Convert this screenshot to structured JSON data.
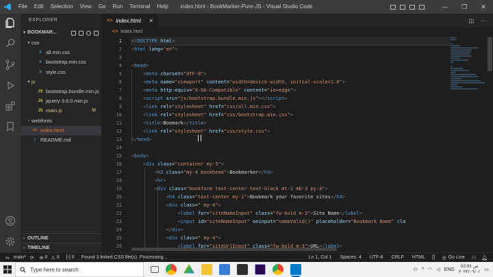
{
  "window": {
    "title": "index.html - BookMarker-Pure-JS - Visual Studio Code",
    "menu": [
      "File",
      "Edit",
      "Selection",
      "View",
      "Go",
      "Run",
      "Terminal",
      "Help"
    ],
    "controls": [
      "—",
      "❐",
      "✕"
    ]
  },
  "sidebar": {
    "title": "EXPLORER",
    "project": "BOOKMAR...",
    "tree": [
      {
        "label": "css",
        "type": "folder",
        "depth": 1,
        "open": true
      },
      {
        "label": "all.min.css",
        "type": "css",
        "depth": 2
      },
      {
        "label": "bootstrap.min.css",
        "type": "css",
        "depth": 2
      },
      {
        "label": "style.css",
        "type": "css",
        "depth": 2
      },
      {
        "label": "js",
        "type": "folder",
        "depth": 1,
        "open": true,
        "modified": true
      },
      {
        "label": "bootstrap.bundle.min.js",
        "type": "js",
        "depth": 2
      },
      {
        "label": "jquery-3.6.0.min.js",
        "type": "js",
        "depth": 2
      },
      {
        "label": "main.js",
        "type": "js",
        "depth": 2,
        "badge": "M",
        "modified": true
      },
      {
        "label": "webfonts",
        "type": "folder",
        "depth": 1,
        "open": false
      },
      {
        "label": "index.html",
        "type": "html",
        "depth": 1,
        "active": true
      },
      {
        "label": "README.md",
        "type": "md",
        "depth": 1
      }
    ],
    "outline": "OUTLINE",
    "timeline": "TIMELINE"
  },
  "editor": {
    "tab": "index.html",
    "breadcrumb": "index.html",
    "current_line": 1,
    "lines": [
      {
        "n": "1",
        "segs": [
          {
            "c": "p",
            "t": "<!"
          },
          {
            "c": "t",
            "t": "DOCTYPE"
          },
          {
            "c": "a",
            "t": " html"
          },
          {
            "c": "p",
            "t": ">"
          }
        ]
      },
      {
        "n": "2",
        "segs": [
          {
            "c": "p",
            "t": "<"
          },
          {
            "c": "t",
            "t": "html"
          },
          {
            "c": "a",
            "t": " lang"
          },
          {
            "c": "x",
            "t": "="
          },
          {
            "c": "s",
            "t": "\"en\""
          },
          {
            "c": "p",
            "t": ">"
          }
        ]
      },
      {
        "n": "3",
        "segs": []
      },
      {
        "n": "4",
        "segs": [
          {
            "c": "p",
            "t": "<"
          },
          {
            "c": "t",
            "t": "head"
          },
          {
            "c": "p",
            "t": ">"
          }
        ]
      },
      {
        "n": "5",
        "segs": [
          {
            "c": "x",
            "t": "    "
          },
          {
            "c": "p",
            "t": "<"
          },
          {
            "c": "t",
            "t": "meta"
          },
          {
            "c": "a",
            "t": " charset"
          },
          {
            "c": "x",
            "t": "="
          },
          {
            "c": "s",
            "t": "\"UTF-8\""
          },
          {
            "c": "p",
            "t": ">"
          }
        ]
      },
      {
        "n": "6",
        "segs": [
          {
            "c": "x",
            "t": "    "
          },
          {
            "c": "p",
            "t": "<"
          },
          {
            "c": "t",
            "t": "meta"
          },
          {
            "c": "a",
            "t": " name"
          },
          {
            "c": "x",
            "t": "="
          },
          {
            "c": "s",
            "t": "\"viewport\""
          },
          {
            "c": "a",
            "t": " content"
          },
          {
            "c": "x",
            "t": "="
          },
          {
            "c": "s",
            "t": "\"width=device-width, initial-scale=1.0\""
          },
          {
            "c": "p",
            "t": ">"
          }
        ]
      },
      {
        "n": "7",
        "segs": [
          {
            "c": "x",
            "t": "    "
          },
          {
            "c": "p",
            "t": "<"
          },
          {
            "c": "t",
            "t": "meta"
          },
          {
            "c": "a",
            "t": " http-equiv"
          },
          {
            "c": "x",
            "t": "="
          },
          {
            "c": "s",
            "t": "\"X-UA-Compatible\""
          },
          {
            "c": "a",
            "t": " content"
          },
          {
            "c": "x",
            "t": "="
          },
          {
            "c": "s",
            "t": "\"ie=edge\""
          },
          {
            "c": "p",
            "t": ">"
          }
        ]
      },
      {
        "n": "8",
        "segs": [
          {
            "c": "x",
            "t": "    "
          },
          {
            "c": "p",
            "t": "<"
          },
          {
            "c": "t",
            "t": "script"
          },
          {
            "c": "a",
            "t": " src"
          },
          {
            "c": "x",
            "t": "="
          },
          {
            "c": "s",
            "t": "\"js/bootstrap.bundle.min.js\""
          },
          {
            "c": "p",
            "t": "></"
          },
          {
            "c": "t",
            "t": "script"
          },
          {
            "c": "p",
            "t": ">"
          }
        ]
      },
      {
        "n": "9",
        "segs": [
          {
            "c": "x",
            "t": "    "
          },
          {
            "c": "p",
            "t": "<"
          },
          {
            "c": "t",
            "t": "link"
          },
          {
            "c": "a",
            "t": " rel"
          },
          {
            "c": "x",
            "t": "="
          },
          {
            "c": "s",
            "t": "\"stylesheet\""
          },
          {
            "c": "a",
            "t": " href"
          },
          {
            "c": "x",
            "t": "="
          },
          {
            "c": "s",
            "t": "\"css/all.min.css\""
          },
          {
            "c": "p",
            "t": ">"
          }
        ]
      },
      {
        "n": "10",
        "segs": [
          {
            "c": "x",
            "t": "    "
          },
          {
            "c": "p",
            "t": "<"
          },
          {
            "c": "t",
            "t": "link"
          },
          {
            "c": "a",
            "t": " rel"
          },
          {
            "c": "x",
            "t": "="
          },
          {
            "c": "s",
            "t": "\"stylesheet\""
          },
          {
            "c": "a",
            "t": " href"
          },
          {
            "c": "x",
            "t": "="
          },
          {
            "c": "s",
            "t": "\"css/bootstrap.min.css\""
          },
          {
            "c": "p",
            "t": ">"
          }
        ]
      },
      {
        "n": "11",
        "segs": [
          {
            "c": "x",
            "t": "    "
          },
          {
            "c": "p",
            "t": "<"
          },
          {
            "c": "t",
            "t": "title"
          },
          {
            "c": "p",
            "t": ">"
          },
          {
            "c": "x",
            "t": "Boomark"
          },
          {
            "c": "p",
            "t": "</"
          },
          {
            "c": "t",
            "t": "title"
          },
          {
            "c": "p",
            "t": ">"
          }
        ]
      },
      {
        "n": "12",
        "segs": [
          {
            "c": "x",
            "t": "    "
          },
          {
            "c": "p",
            "t": "<"
          },
          {
            "c": "t",
            "t": "link"
          },
          {
            "c": "a",
            "t": " rel"
          },
          {
            "c": "x",
            "t": "="
          },
          {
            "c": "s",
            "t": "\"stylesheet\""
          },
          {
            "c": "a",
            "t": " href"
          },
          {
            "c": "x",
            "t": "="
          },
          {
            "c": "s",
            "t": "\"css/style.css\""
          },
          {
            "c": "p",
            "t": ">"
          }
        ]
      },
      {
        "n": "13",
        "segs": [
          {
            "c": "p",
            "t": "</"
          },
          {
            "c": "t",
            "t": "head"
          },
          {
            "c": "p",
            "t": ">"
          }
        ]
      },
      {
        "n": "14",
        "segs": []
      },
      {
        "n": "15",
        "segs": [
          {
            "c": "p",
            "t": "<"
          },
          {
            "c": "t",
            "t": "body"
          },
          {
            "c": "p",
            "t": ">"
          }
        ]
      },
      {
        "n": "16",
        "segs": [
          {
            "c": "x",
            "t": "    "
          },
          {
            "c": "p",
            "t": "<"
          },
          {
            "c": "t",
            "t": "div"
          },
          {
            "c": "a",
            "t": " class"
          },
          {
            "c": "x",
            "t": "="
          },
          {
            "c": "s",
            "t": "\"container my-5\""
          },
          {
            "c": "p",
            "t": ">"
          }
        ]
      },
      {
        "n": "17",
        "segs": [
          {
            "c": "x",
            "t": "        "
          },
          {
            "c": "p",
            "t": "<"
          },
          {
            "c": "t",
            "t": "h3"
          },
          {
            "c": "a",
            "t": " class"
          },
          {
            "c": "x",
            "t": "="
          },
          {
            "c": "s",
            "t": "\"my-4 bookhead\""
          },
          {
            "c": "p",
            "t": ">"
          },
          {
            "c": "x",
            "t": "Bookmarker"
          },
          {
            "c": "p",
            "t": "</"
          },
          {
            "c": "t",
            "t": "h3"
          },
          {
            "c": "p",
            "t": ">"
          }
        ]
      },
      {
        "n": "18",
        "segs": [
          {
            "c": "x",
            "t": "        "
          },
          {
            "c": "p",
            "t": "<"
          },
          {
            "c": "t",
            "t": "hr"
          },
          {
            "c": "p",
            "t": ">"
          }
        ]
      },
      {
        "n": "19",
        "segs": [
          {
            "c": "x",
            "t": "        "
          },
          {
            "c": "p",
            "t": "<"
          },
          {
            "c": "t",
            "t": "div"
          },
          {
            "c": "a",
            "t": " class"
          },
          {
            "c": "x",
            "t": "="
          },
          {
            "c": "s",
            "t": "\"bookform text-center text-black mt-1 mb-3 py-3\""
          },
          {
            "c": "p",
            "t": ">"
          }
        ]
      },
      {
        "n": "20",
        "segs": [
          {
            "c": "x",
            "t": "            "
          },
          {
            "c": "p",
            "t": "<"
          },
          {
            "c": "t",
            "t": "h4"
          },
          {
            "c": "a",
            "t": " class"
          },
          {
            "c": "x",
            "t": "="
          },
          {
            "c": "s",
            "t": "\"text-center my-1\""
          },
          {
            "c": "p",
            "t": ">"
          },
          {
            "c": "x",
            "t": "Bookmark your favorite sites"
          },
          {
            "c": "p",
            "t": "</"
          },
          {
            "c": "t",
            "t": "h4"
          },
          {
            "c": "p",
            "t": ">"
          }
        ]
      },
      {
        "n": "21",
        "segs": [
          {
            "c": "x",
            "t": "            "
          },
          {
            "c": "p",
            "t": "<"
          },
          {
            "c": "t",
            "t": "div"
          },
          {
            "c": "a",
            "t": " class"
          },
          {
            "c": "x",
            "t": "="
          },
          {
            "c": "s",
            "t": "\" my-4\""
          },
          {
            "c": "p",
            "t": ">"
          }
        ]
      },
      {
        "n": "22",
        "segs": [
          {
            "c": "x",
            "t": "                "
          },
          {
            "c": "p",
            "t": "<"
          },
          {
            "c": "t",
            "t": "label"
          },
          {
            "c": "a",
            "t": " for"
          },
          {
            "c": "x",
            "t": "="
          },
          {
            "c": "s",
            "t": "\"siteNameInput\""
          },
          {
            "c": "a",
            "t": " class"
          },
          {
            "c": "x",
            "t": "="
          },
          {
            "c": "s",
            "t": "\"fw-bold m-3\""
          },
          {
            "c": "p",
            "t": ">"
          },
          {
            "c": "x",
            "t": "Site Name"
          },
          {
            "c": "p",
            "t": "</"
          },
          {
            "c": "t",
            "t": "label"
          },
          {
            "c": "p",
            "t": ">"
          }
        ]
      },
      {
        "n": "23",
        "segs": [
          {
            "c": "x",
            "t": "                "
          },
          {
            "c": "p",
            "t": "<"
          },
          {
            "c": "t",
            "t": "input"
          },
          {
            "c": "a",
            "t": " id"
          },
          {
            "c": "x",
            "t": "="
          },
          {
            "c": "s",
            "t": "\"siteNameInput\""
          },
          {
            "c": "a",
            "t": " oninput"
          },
          {
            "c": "x",
            "t": "="
          },
          {
            "c": "s",
            "t": "\"nameValid()\""
          },
          {
            "c": "a",
            "t": " placeholder"
          },
          {
            "c": "x",
            "t": "="
          },
          {
            "c": "s",
            "t": "\"Bookmark Name\""
          },
          {
            "c": "a",
            "t": " cla"
          }
        ]
      },
      {
        "n": "24",
        "segs": [
          {
            "c": "x",
            "t": "            "
          },
          {
            "c": "p",
            "t": "</"
          },
          {
            "c": "t",
            "t": "div"
          },
          {
            "c": "p",
            "t": ">"
          }
        ]
      },
      {
        "n": "25",
        "segs": [
          {
            "c": "x",
            "t": "            "
          },
          {
            "c": "p",
            "t": "<"
          },
          {
            "c": "t",
            "t": "div"
          },
          {
            "c": "a",
            "t": " class"
          },
          {
            "c": "x",
            "t": "="
          },
          {
            "c": "s",
            "t": "\" my-4\""
          },
          {
            "c": "p",
            "t": ">"
          }
        ]
      },
      {
        "n": "26",
        "segs": [
          {
            "c": "x",
            "t": "                "
          },
          {
            "c": "p",
            "t": "<"
          },
          {
            "c": "t",
            "t": "label"
          },
          {
            "c": "a",
            "t": " for"
          },
          {
            "c": "x",
            "t": "="
          },
          {
            "c": "s",
            "t": "\"siteUrlInput\""
          },
          {
            "c": "a",
            "t": " class"
          },
          {
            "c": "x",
            "t": "="
          },
          {
            "c": "s",
            "t": "\"fw-bold m-3\""
          },
          {
            "c": "p",
            "t": ">"
          },
          {
            "c": "x",
            "t": "URL"
          },
          {
            "c": "p",
            "t": "</"
          },
          {
            "c": "t",
            "t": "label"
          },
          {
            "c": "p",
            "t": ">"
          }
        ]
      }
    ]
  },
  "statusbar": {
    "branch": "main*",
    "sync": "⟳",
    "errors": "0",
    "warnings": "0",
    "ports": "[-] 0",
    "message": "Found 3 linked CSS file(s). Processing...",
    "position": "Ln 1, Col 1",
    "spaces": "Spaces: 4",
    "encoding": "UTF-8",
    "eol": "CRLF",
    "language": "HTML",
    "golive": "Go Live"
  },
  "taskbar": {
    "search_placeholder": "Type here to search",
    "lang": "ENG",
    "time": "02:01 ص",
    "date": "٢٠٢٢/٠٦/٠١"
  },
  "colors": {
    "accent": "#0078d4",
    "folder": "#dcb67a",
    "css": "#519aba",
    "js": "#cbcb41",
    "html": "#e37933",
    "md": "#519aba",
    "modified": "#e2c08d"
  }
}
